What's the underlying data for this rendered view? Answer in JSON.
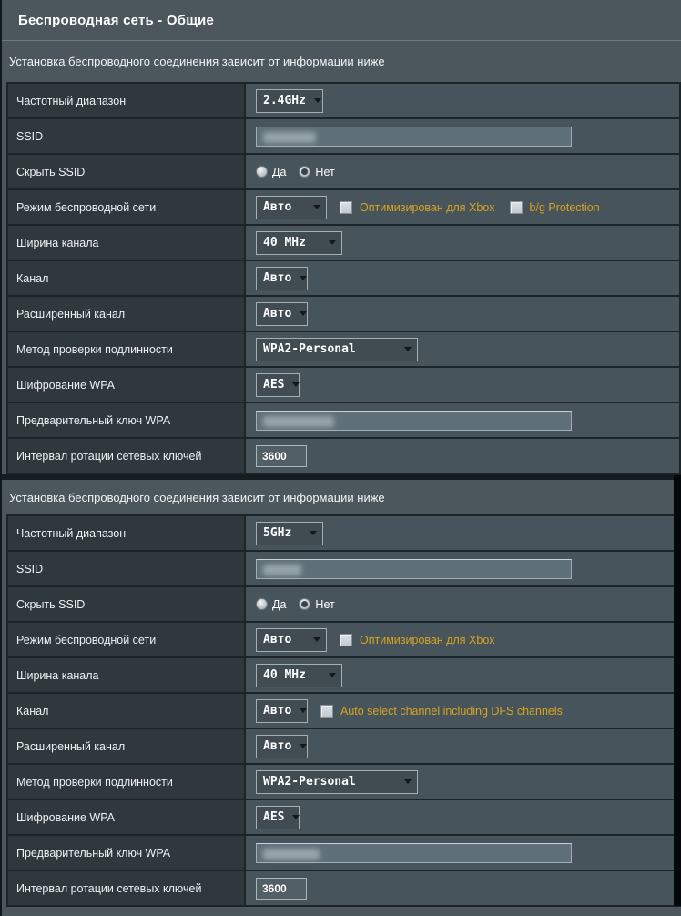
{
  "page": {
    "title": "Беспроводная сеть - Общие"
  },
  "colors": {
    "accent_orange": "#d7a41e",
    "panel_bg": "#4b565d",
    "label_cell_bg": "#2f383d",
    "value_cell_bg": "#48545b"
  },
  "sections": [
    {
      "header": "Установка беспроводного соединения зависит от информации ниже",
      "rows": {
        "band": {
          "label": "Частотный диапазон",
          "value": "2.4GHz"
        },
        "ssid": {
          "label": "SSID",
          "value_obscured": true
        },
        "hide_ssid": {
          "label": "Скрыть SSID",
          "options": [
            "Да",
            "Нет"
          ],
          "selected": "Нет"
        },
        "mode": {
          "label": "Режим беспроводной сети",
          "value": "Авто",
          "checkboxes": [
            "Оптимизирован для Xbox",
            "b/g Protection"
          ],
          "checked": [
            false,
            false
          ]
        },
        "channel_width": {
          "label": "Ширина канала",
          "value": "40 MHz"
        },
        "channel": {
          "label": "Канал",
          "value": "Авто"
        },
        "ext_channel": {
          "label": "Расширенный канал",
          "value": "Авто"
        },
        "auth": {
          "label": "Метод проверки подлинности",
          "value": "WPA2-Personal"
        },
        "wpa_encryption": {
          "label": "Шифрование WPA",
          "value": "AES"
        },
        "wpa_key": {
          "label": "Предварительный ключ WPA",
          "value_obscured": true
        },
        "key_rotation": {
          "label": "Интервал ротации сетевых ключей",
          "value": "3600"
        }
      }
    },
    {
      "header": "Установка беспроводного соединения зависит от информации ниже",
      "rows": {
        "band": {
          "label": "Частотный диапазон",
          "value": "5GHz"
        },
        "ssid": {
          "label": "SSID",
          "value_obscured": true
        },
        "hide_ssid": {
          "label": "Скрыть SSID",
          "options": [
            "Да",
            "Нет"
          ],
          "selected": "Нет"
        },
        "mode": {
          "label": "Режим беспроводной сети",
          "value": "Авто",
          "checkboxes": [
            "Оптимизирован для Xbox"
          ],
          "checked": [
            false
          ]
        },
        "channel_width": {
          "label": "Ширина канала",
          "value": "40 MHz"
        },
        "channel": {
          "label": "Канал",
          "value": "Авто",
          "checkbox": "Auto select channel including DFS channels",
          "checkbox_checked": false
        },
        "ext_channel": {
          "label": "Расширенный канал",
          "value": "Авто"
        },
        "auth": {
          "label": "Метод проверки подлинности",
          "value": "WPA2-Personal"
        },
        "wpa_encryption": {
          "label": "Шифрование WPA",
          "value": "AES"
        },
        "wpa_key": {
          "label": "Предварительный ключ WPA",
          "value_obscured": true
        },
        "key_rotation": {
          "label": "Интервал ротации сетевых ключей",
          "value": "3600"
        }
      }
    }
  ]
}
